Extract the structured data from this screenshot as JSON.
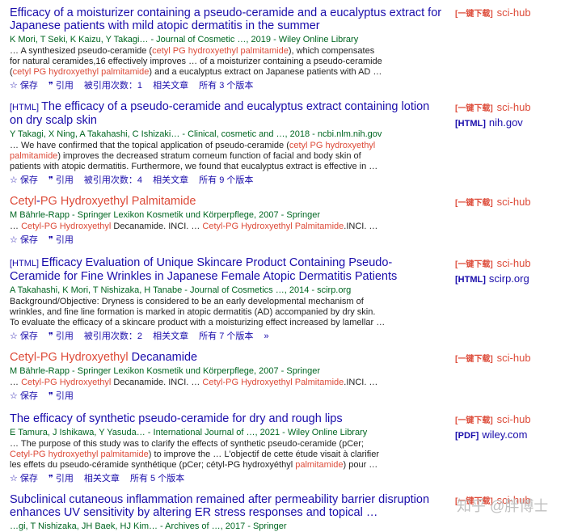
{
  "results": [
    {
      "title": "Efficacy of a moisturizer containing a pseudo-ceramide and a eucalyptus extract for Japanese patients with mild atopic dermatitis in the summer",
      "authors": "K Mori, T Seki, K Kaizu, Y Takagi… - Journal of Cosmetic …, 2019 - Wiley Online Library",
      "snippet_l1a": "… A synthesized pseudo-ceramide (",
      "snippet_l1hl": "cetyl PG hydroxyethyl palmitamide",
      "snippet_l1b": "), which compensates",
      "snippet_l2": "for natural ceramides,16 effectively improves … of a moisturizer containing a pseudo-ceramide",
      "snippet_l3a": "(",
      "snippet_l3hl": "cetyl PG hydroxyethyl palmitamide",
      "snippet_l3b": ") and a eucalyptus extract on Japanese patients with AD …",
      "save": "保存",
      "cite": "引用",
      "cited_by": "被引用次数：1",
      "related": "相关文章",
      "versions": "所有 3 个版本",
      "side_btn": "[一键下载]",
      "side_src": "sci-hub"
    },
    {
      "tag": "[HTML]",
      "title": "The efficacy of a pseudo-ceramide and eucalyptus extract containing lotion on dry scalp skin",
      "authors": "Y Takagi, X Ning, A Takahashi, C Ishizaki… - Clinical, cosmetic and …, 2018 - ncbi.nlm.nih.gov",
      "snippet_l1a": "… We have confirmed that the topical application of pseudo-ceramide (",
      "snippet_l1hl": "cetyl PG hydroxyethyl",
      "snippet_l2hl": "palmitamide",
      "snippet_l2b": ") improves the decreased stratum corneum function of facial and body skin of",
      "snippet_l3": "patients with atopic dermatitis. Furthermore, we found that eucalyptus extract is effective in …",
      "save": "保存",
      "cite": "引用",
      "cited_by": "被引用次数：4",
      "related": "相关文章",
      "versions": "所有 9 个版本",
      "side_btn": "[一键下载]",
      "side_src": "sci-hub",
      "side_tag2": "[HTML]",
      "side_src2": "nih.gov"
    },
    {
      "title_a": "Cetyl",
      "title_b": "-",
      "title_c": "PG Hydroxyethyl Palmitamide",
      "authors": "M Bährle-Rapp - Springer Lexikon Kosmetik und Körperpflege, 2007 - Springer",
      "snippet_a": "… ",
      "snippet_hl1": "Cetyl-PG Hydroxyethyl",
      "snippet_b": " Decanamide. INCI. … ",
      "snippet_hl2": "Cetyl-PG Hydroxyethyl Palmitamide",
      "snippet_c": ".INCI. …",
      "save": "保存",
      "cite": "引用",
      "side_btn": "[一键下载]",
      "side_src": "sci-hub"
    },
    {
      "tag": "[HTML]",
      "title": "Efficacy Evaluation of Unique Skincare Product Containing Pseudo-Ceramide for Fine Wrinkles in Japanese Female Atopic Dermatitis Patients",
      "authors": "A Takahashi, K Mori, T Nishizaka, H Tanabe - Journal of Cosmetics …, 2014 - scirp.org",
      "snippet_l1": "Background/Objective: Dryness is considered to be an early developmental mechanism of",
      "snippet_l2": "wrinkles, and fine line formation is marked in atopic dermatitis (AD) accompanied by dry skin.",
      "snippet_l3": "To evaluate the efficacy of a skincare product with a moisturizing effect increased by lamellar …",
      "save": "保存",
      "cite": "引用",
      "cited_by": "被引用次数：2",
      "related": "相关文章",
      "versions": "所有 7 个版本",
      "more": "»",
      "side_btn": "[一键下载]",
      "side_src": "sci-hub",
      "side_tag2": "[HTML]",
      "side_src2": "scirp.org"
    },
    {
      "title_a": "Cetyl-PG Hydroxyethyl",
      "title_b": " Decanamide",
      "authors": "M Bährle-Rapp - Springer Lexikon Kosmetik und Körperpflege, 2007 - Springer",
      "snippet_a": "… ",
      "snippet_hl1": "Cetyl-PG Hydroxyethyl",
      "snippet_b": " Decanamide. INCI. … ",
      "snippet_hl2": "Cetyl-PG Hydroxyethyl Palmitamide",
      "snippet_c": ".INCI. …",
      "save": "保存",
      "cite": "引用",
      "side_btn": "[一键下载]",
      "side_src": "sci-hub"
    },
    {
      "title": "The efficacy of synthetic pseudo-ceramide for dry and rough lips",
      "authors": "E Tamura, J Ishikawa, Y Yasuda… - International Journal of …, 2021 - Wiley Online Library",
      "snippet_l1": "… The purpose of this study was to clarify the effects of synthetic pseudo-ceramide (pCer;",
      "snippet_l2hl": "Cetyl-PG hydroxyethyl palmitamide",
      "snippet_l2b": ") to improve the … L'objectif de cette étude visait à clarifier",
      "snippet_l3a": "les effets du pseudo-céramide synthétique (pCer; cétyl-PG hydroxyéthyl ",
      "snippet_l3hl": "palmitamide",
      "snippet_l3b": ") pour …",
      "save": "保存",
      "cite": "引用",
      "related": "相关文章",
      "versions": "所有 5 个版本",
      "side_btn": "[一键下载]",
      "side_src": "sci-hub",
      "side_tag2": "[PDF]",
      "side_src2": "wiley.com"
    },
    {
      "title": "Subclinical cutaneous inflammation remained after permeability barrier disruption enhances UV sensitivity by altering ER stress responses and topical …",
      "authors": "…gi, T Nishizaka, JH Baek, HJ Kim… - Archives of …, 2017 - Springer",
      "side_btn": "[一键下载]",
      "side_src": "sci-hub"
    }
  ],
  "watermark": "知乎 @胖博士"
}
